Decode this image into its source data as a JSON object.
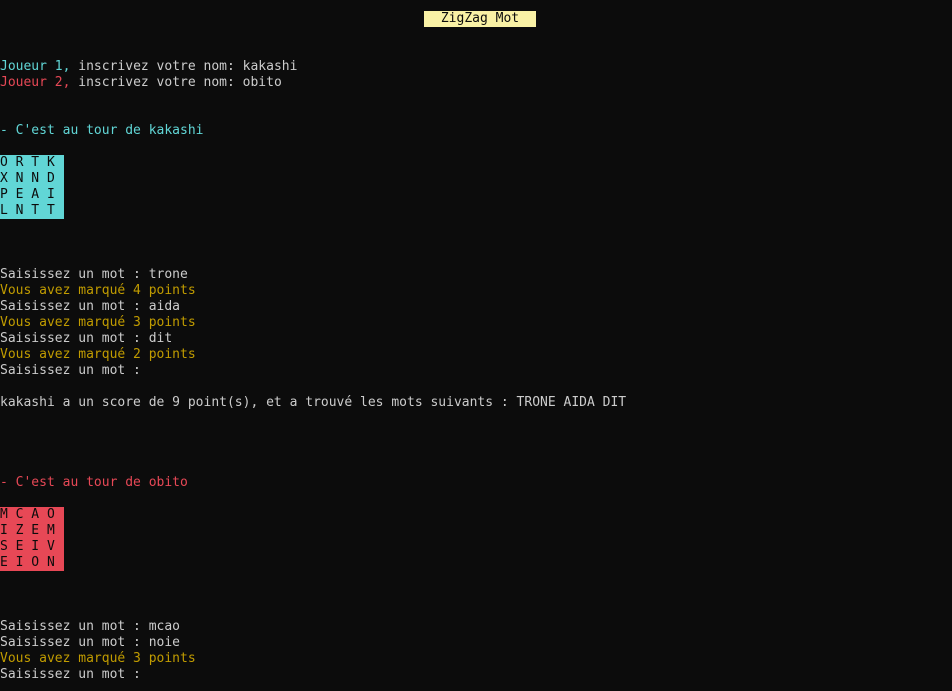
{
  "title": "ZigZag Mot",
  "setup": {
    "player1_label": "Joueur 1,",
    "player1_prompt": " inscrivez votre nom: kakashi",
    "player2_label": "Joueur 2,",
    "player2_prompt": " inscrivez votre nom: obito"
  },
  "turn1": {
    "header": "- C'est au tour de kakashi",
    "grid": [
      "O R T K",
      "X N N D",
      "P E A I",
      "L N T T"
    ],
    "log": [
      "Saisissez un mot : trone",
      "Vous avez marqué 4 points",
      "Saisissez un mot : aida",
      "Vous avez marqué 3 points",
      "Saisissez un mot : dit",
      "Vous avez marqué 2 points",
      "Saisissez un mot :"
    ],
    "summary": "kakashi a un score de 9 point(s), et a trouvé les mots suivants : TRONE AIDA DIT"
  },
  "turn2": {
    "header": "- C'est au tour de obito",
    "grid": [
      "M C A O",
      "I Z E M",
      "S E I V",
      "E I O N"
    ],
    "log": [
      "Saisissez un mot : mcao",
      "Saisissez un mot : noie",
      "Vous avez marqué 3 points",
      "Saisissez un mot :"
    ]
  },
  "colors": {
    "background": "#0c0c0c",
    "text": "#cccccc",
    "player1": "#61d6d6",
    "player2": "#e74856",
    "score": "#c19c00",
    "title_bg": "#f9f1a5"
  }
}
